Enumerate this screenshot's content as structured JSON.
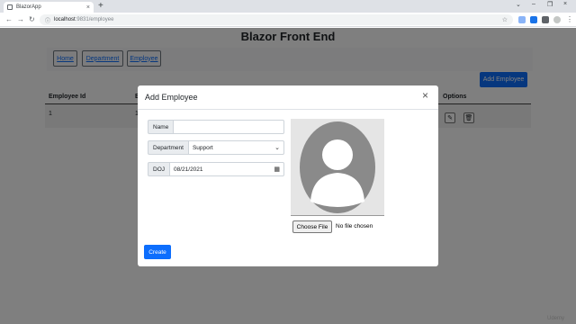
{
  "browser": {
    "tab_title": "BlazorApp",
    "tab_close": "×",
    "new_tab": "+",
    "url_host": "localhost",
    "url_path": ":9831/employee",
    "window_controls": [
      "⌄",
      "–",
      "❐",
      "×"
    ]
  },
  "page": {
    "title": "Blazor Front End",
    "nav": [
      "Home",
      "Department",
      "Employee"
    ],
    "add_button": "Add Employee",
    "table": {
      "headers": [
        "Employee Id",
        "E",
        "Options"
      ],
      "rows": [
        [
          "1",
          "1"
        ]
      ]
    }
  },
  "modal": {
    "title": "Add Employee",
    "close": "×",
    "fields": {
      "name_label": "Name",
      "name_value": "",
      "department_label": "Department",
      "department_value": "Support",
      "doj_label": "DOJ",
      "doj_value": "08/21/2021"
    },
    "choose_file": "Choose File",
    "no_file": "No file chosen",
    "create": "Create"
  },
  "watermark": "Udemy"
}
